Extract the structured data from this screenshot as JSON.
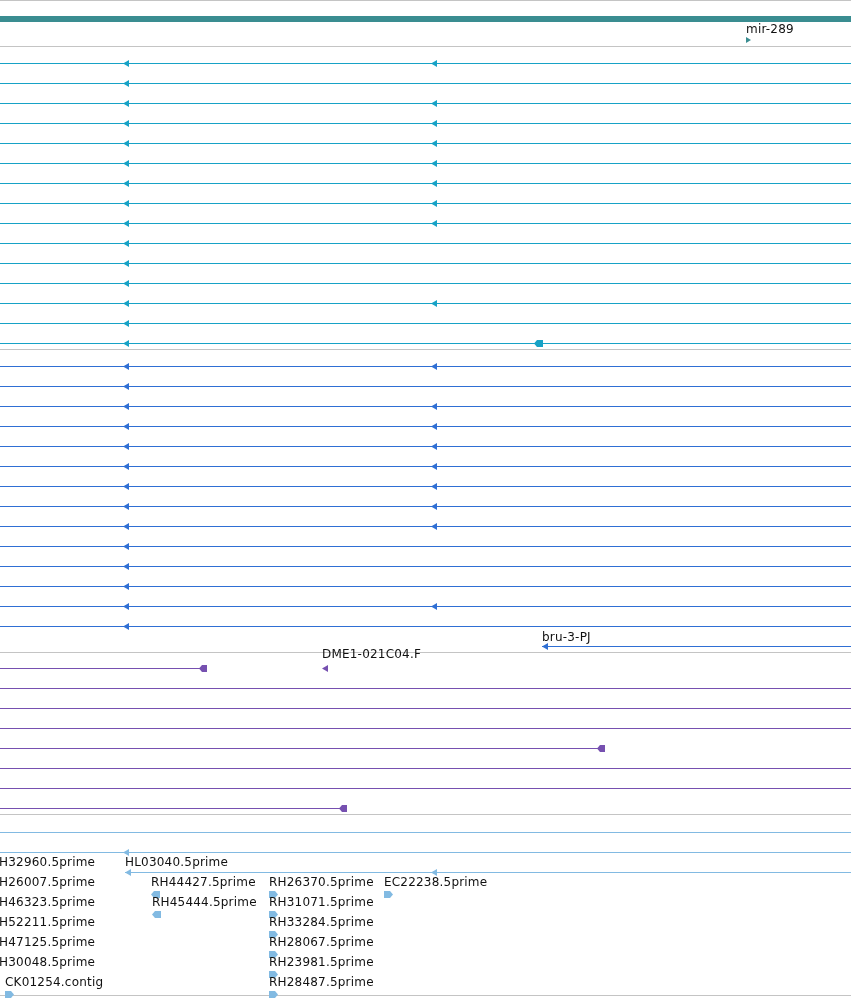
{
  "gene_track": {
    "features": [
      {
        "label": "mir-289",
        "reverse": false
      }
    ]
  },
  "tracks": [
    {
      "kind": "transcripts",
      "color": "#17a2c6",
      "rows": [
        {
          "kind": "two-arrows"
        },
        {
          "kind": "one-arrow"
        },
        {
          "kind": "two-arrows"
        },
        {
          "kind": "two-arrows"
        },
        {
          "kind": "two-arrows"
        },
        {
          "kind": "two-arrows"
        },
        {
          "kind": "two-arrows"
        },
        {
          "kind": "two-arrows"
        },
        {
          "kind": "two-arrows"
        },
        {
          "kind": "one-arrow"
        },
        {
          "kind": "one-arrow"
        },
        {
          "kind": "one-arrow"
        },
        {
          "kind": "two-arrows"
        },
        {
          "kind": "one-arrow"
        },
        {
          "kind": "arrow-block"
        }
      ]
    },
    {
      "kind": "transcripts",
      "color": "#2f6fd4",
      "rows": [
        {
          "kind": "two-arrows"
        },
        {
          "kind": "one-arrow"
        },
        {
          "kind": "two-arrows"
        },
        {
          "kind": "two-arrows"
        },
        {
          "kind": "two-arrows"
        },
        {
          "kind": "two-arrows"
        },
        {
          "kind": "two-arrows"
        },
        {
          "kind": "two-arrows"
        },
        {
          "kind": "two-arrows"
        },
        {
          "kind": "one-arrow"
        },
        {
          "kind": "one-arrow"
        },
        {
          "kind": "one-arrow"
        },
        {
          "kind": "two-arrows"
        },
        {
          "kind": "one-arrow"
        },
        {
          "kind": "labeled",
          "label": "bru-3-PJ"
        }
      ]
    },
    {
      "kind": "transcripts",
      "color": "#7650b0",
      "rows": [
        {
          "kind": "end-labeled",
          "label": "DME1-021C04.F"
        },
        {
          "kind": "plain"
        },
        {
          "kind": "plain"
        },
        {
          "kind": "plain"
        },
        {
          "kind": "end"
        },
        {
          "kind": "plain"
        },
        {
          "kind": "plain"
        },
        {
          "kind": "end"
        }
      ]
    },
    {
      "kind": "transcripts",
      "color": "#82bae2",
      "rows": [
        {
          "kind": "plain"
        },
        {
          "kind": "one-arrow"
        }
      ]
    }
  ],
  "est_track": {
    "color": "#82bae2",
    "lanes": [
      [
        {
          "kind": "read",
          "label": "H32960.5prime"
        },
        {
          "kind": "spliced",
          "label": "HL03040.5prime"
        }
      ],
      [
        {
          "kind": "read",
          "label": "H26007.5prime"
        },
        {
          "kind": "read",
          "label": "RH44427.5prime",
          "reverse": true
        },
        {
          "kind": "read",
          "label": "RH26370.5prime",
          "reverse": false
        },
        {
          "kind": "read",
          "label": "EC22238.5prime",
          "reverse": false
        }
      ],
      [
        {
          "kind": "read",
          "label": "H46323.5prime"
        },
        {
          "kind": "read",
          "label": "RH45444.5prime",
          "reverse": true
        },
        {
          "kind": "read",
          "label": "RH31071.5prime",
          "reverse": false
        }
      ],
      [
        {
          "kind": "read",
          "label": "H52211.5prime"
        },
        {
          "kind": "read",
          "label": "RH33284.5prime",
          "reverse": false
        }
      ],
      [
        {
          "kind": "read",
          "label": "H47125.5prime"
        },
        {
          "kind": "read",
          "label": "RH28067.5prime",
          "reverse": false
        }
      ],
      [
        {
          "kind": "read",
          "label": "H30048.5prime"
        },
        {
          "kind": "read",
          "label": "RH23981.5prime",
          "reverse": false
        }
      ],
      [
        {
          "kind": "read",
          "label": "CK01254.contig",
          "reverse": false
        },
        {
          "kind": "read",
          "label": "RH28487.5prime",
          "reverse": false
        }
      ]
    ]
  }
}
